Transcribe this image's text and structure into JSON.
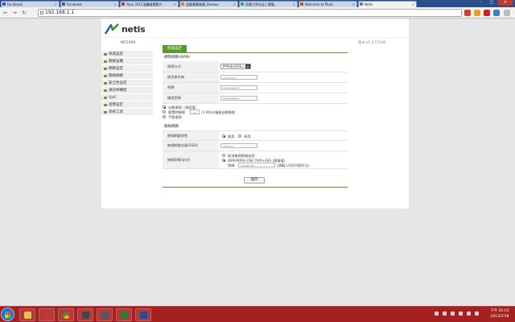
{
  "browser": {
    "tabs": [
      {
        "label": "Facebook",
        "active": false,
        "color": "#3b5998"
      },
      {
        "label": "Facebook",
        "active": false,
        "color": "#3b5998"
      },
      {
        "label": "Yoyo 2011溫馨聲響影片",
        "active": false,
        "color": "#c0392b"
      },
      {
        "label": "溫暖聲響故事_Reezoo",
        "active": false,
        "color": "#e67e22"
      },
      {
        "label": "遊戲工房分店 | 電腦...",
        "active": false,
        "color": "#27ae60"
      },
      {
        "label": "Welcome to Plurk",
        "active": false,
        "color": "#d35400"
      },
      {
        "label": "Netis",
        "active": true,
        "color": "#777777"
      }
    ],
    "url": "192.168.1.1"
  },
  "header": {
    "brand": "netis"
  },
  "sidebar": {
    "model": "WF2409",
    "items": [
      {
        "label": "快速設定"
      },
      {
        "label": "無線設備"
      },
      {
        "label": "網路設定"
      },
      {
        "label": "無線網路"
      },
      {
        "label": "安全性設定"
      },
      {
        "label": "通訊埠轉發"
      },
      {
        "label": "QoS"
      },
      {
        "label": "進階設定"
      },
      {
        "label": "系統工具"
      }
    ]
  },
  "content": {
    "tab": "快速設定",
    "wan": {
      "heading": "網際網路(WAN)",
      "mode_label": "連線方式",
      "mode_value": "PPPoE(ADSL)",
      "username_label": "使用者名稱",
      "username_value": "Amanda",
      "password_label": "密碼",
      "password_value": "•••••••••",
      "confirm_label": "確認密碼",
      "confirm_value": "•••••••••",
      "opt_auto": "自動連線（預設值）",
      "opt_idle_prefix": "閒置時斷線",
      "opt_idle_value": "15",
      "opt_idle_suffix": "(1-99)分鐘後自動斷線",
      "opt_manual": "手動連線"
    },
    "wireless": {
      "heading": "無線網路",
      "status_label": "無線網路狀態",
      "on": "啟用",
      "off": "停用",
      "ssid_label": "無線網路名稱(SSID)",
      "ssid_value": "Steven",
      "security_label": "無線密碼(安全)",
      "sec_none": "取消無線網路加密",
      "sec_wpa": "WPA/WPA2-PSK TKIP+AES (建議值)",
      "key_label": "密碼",
      "key_value": "asdfghjkl",
      "key_hint": "(請輸入8至63個字元)"
    },
    "save": "儲存"
  },
  "version": "版本:V1.4.17548",
  "taskbar": {
    "time": "下午 05:01",
    "date": "2013/7/18"
  }
}
